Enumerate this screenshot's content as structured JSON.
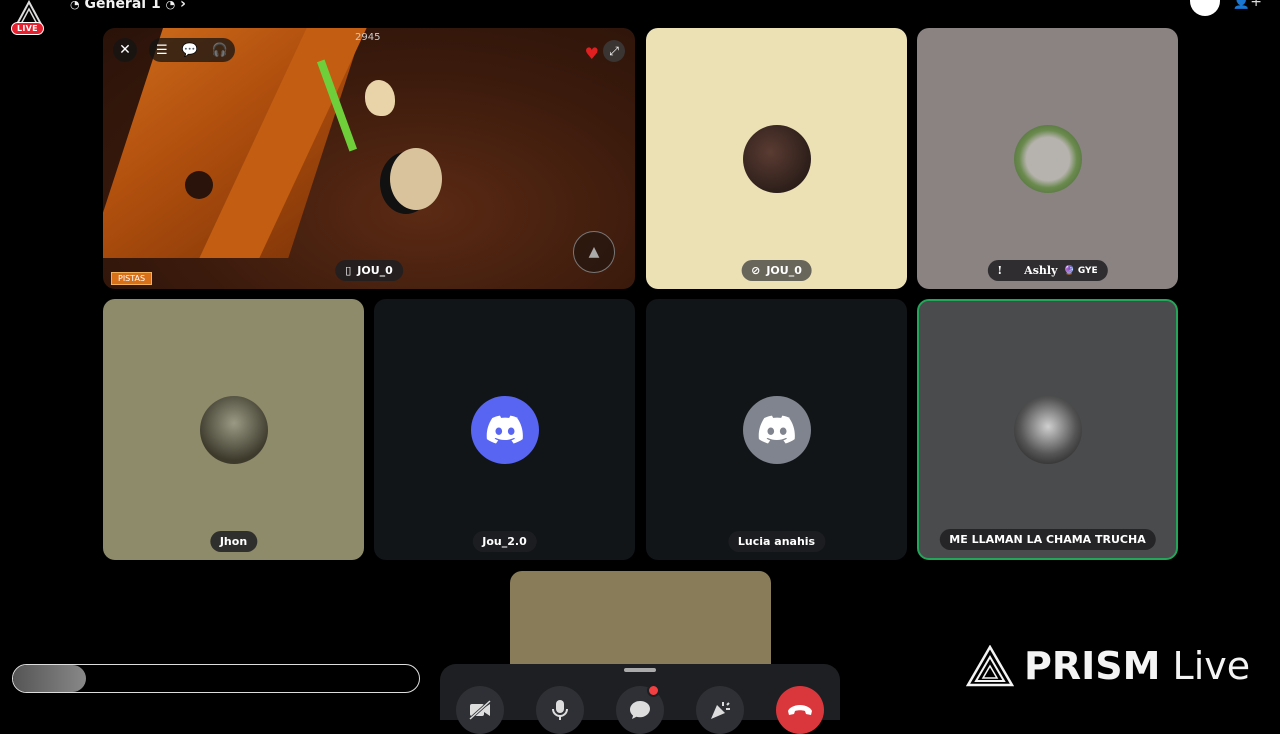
{
  "topbar": {
    "live_badge": "LIVE",
    "channel_name": "General 1",
    "chevron": "›"
  },
  "game_tile": {
    "counter": "2945",
    "participant": "JOU_0",
    "tag": "PISTAS",
    "icons": [
      "close-icon",
      "menu-icon",
      "chat-icon",
      "headset-icon",
      "heart-rate-icon",
      "expand-icon",
      "jump-icon"
    ]
  },
  "participants": [
    {
      "name": "JOU_0",
      "bg": "#ece1b5",
      "badge_icon": "no-stream-icon"
    },
    {
      "name": "Ashly",
      "prefix": "!",
      "tag": "GYE",
      "bg": "#8a8382"
    },
    {
      "name": "Jhon",
      "bg": "#8e8b6a"
    },
    {
      "name": "Jou_2.0",
      "bg": "#111518",
      "avatar_color": "#5865f2"
    },
    {
      "name": "Lucia anahis",
      "bg": "#111518",
      "avatar_color": "#80848e"
    },
    {
      "name": "ME LLAMAN LA CHAMA TRUCHA",
      "bg": "#4a4b4c",
      "speaking_color": "#23a55a"
    }
  ],
  "progress": {
    "fraction": 0.18
  },
  "controls": {
    "camera_off_icon": "camera-off-icon",
    "mic_icon": "microphone-icon",
    "chat_icon": "chat-icon",
    "activities_icon": "activities-icon",
    "hangup_icon": "hang-up-icon"
  },
  "watermark": {
    "brand": "PRISM",
    "suffix": "Live"
  }
}
